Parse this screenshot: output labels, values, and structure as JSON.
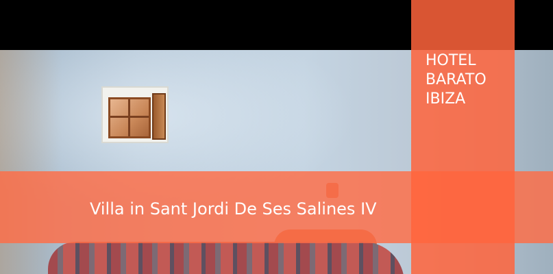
{
  "brand": {
    "lines": [
      "HOTEL",
      "BARATO",
      "IBIZA"
    ]
  },
  "title": "Villa in Sant Jordi De Ses Salines IV",
  "colors": {
    "accent": "#ff6c46",
    "background_top": "#000000"
  }
}
